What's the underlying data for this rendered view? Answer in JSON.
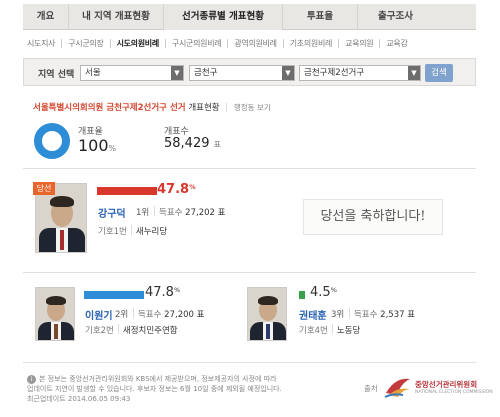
{
  "topnav": {
    "tabs": [
      {
        "label": "개요"
      },
      {
        "label": "내 지역 개표현황"
      },
      {
        "label": "선거종류별 개표현황"
      },
      {
        "label": "투표율"
      },
      {
        "label": "출구조사"
      }
    ]
  },
  "subnav": {
    "items": [
      {
        "label": "시도지사"
      },
      {
        "label": "구시군의장"
      },
      {
        "label": "시도의원비례"
      },
      {
        "label": "구시군의원비례"
      },
      {
        "label": "광역의원비례"
      },
      {
        "label": "기초의원비례"
      },
      {
        "label": "교육의원"
      },
      {
        "label": "교육감"
      }
    ]
  },
  "search": {
    "label": "지역 선택",
    "province": "서울",
    "district": "금천구",
    "constituency": "금천구제2선거구",
    "button": "검색"
  },
  "headline": {
    "title": "서울특별시의회의원 금천구제2선거구 선거",
    "suffix": "개표현황",
    "map_link": "행정동 보기"
  },
  "summary": {
    "rate_label": "개표율",
    "rate_value": "100",
    "rate_unit": "%",
    "count_label": "개표수",
    "count_value": "58,429",
    "count_unit": "표",
    "donut_color": "#2d8dd6"
  },
  "winner": {
    "badge": "당선",
    "pct": "47.8",
    "pct_unit": "%",
    "bar_fraction": 0.478,
    "bar_color": "#d9372b",
    "name": "강구덕",
    "rank": "1위",
    "votes_label": "득표수",
    "votes": "27,202",
    "votes_unit": "표",
    "number_label": "기호1번",
    "party": "새누리당",
    "congrats": "당선을 축하합니다!"
  },
  "candidates": [
    {
      "pct": "47.8",
      "pct_unit": "%",
      "bar_fraction": 0.478,
      "bar_color": "#2d8dd6",
      "name": "이원기",
      "rank": "2위",
      "votes_label": "득표수",
      "votes": "27,200",
      "votes_unit": "표",
      "number_label": "기호2번",
      "party": "새정치민주연합"
    },
    {
      "pct": "4.5",
      "pct_unit": "%",
      "bar_fraction": 0.045,
      "bar_color": "#3aa14a",
      "name": "권태훈",
      "rank": "3위",
      "votes_label": "득표수",
      "votes": "2,537",
      "votes_unit": "표",
      "number_label": "기호4번",
      "party": "노동당"
    }
  ],
  "footer": {
    "line1": "본 정보는 중앙선거관리위원회와 KBS에서 제공받으며, 정보제공자의 사정에 따라",
    "line2": "업데이트 지연이 발생할 수 있습니다. 후보자 정보는 6월 10일 중에 제외될 예정입니다.",
    "updated": "최근업데이트 2014.06.05 09:43",
    "source_label": "출처",
    "org_name": "중앙선거관리위원회",
    "org_en": "NATIONAL ELECTION COMMISSION"
  }
}
